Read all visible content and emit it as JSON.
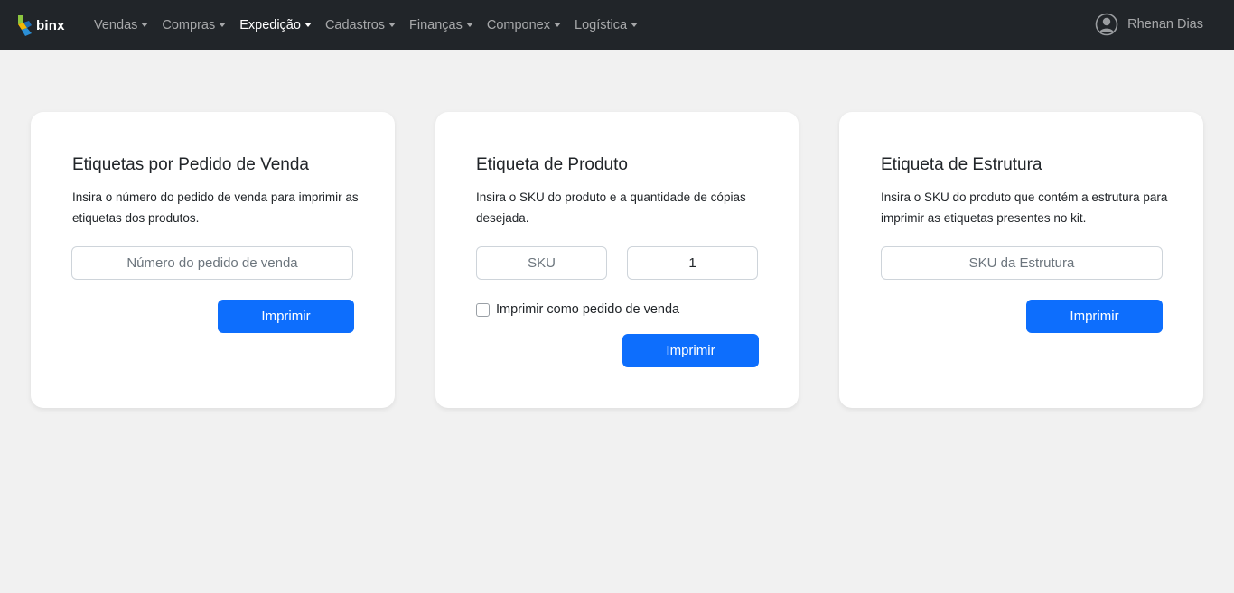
{
  "brand": {
    "name": "binx",
    "logo_icon": "binx-logo-icon"
  },
  "nav": {
    "items": [
      {
        "label": "Vendas"
      },
      {
        "label": "Compras"
      },
      {
        "label": "Expedição",
        "active": true
      },
      {
        "label": "Cadastros"
      },
      {
        "label": "Finanças"
      },
      {
        "label": "Componex"
      },
      {
        "label": "Logística"
      }
    ]
  },
  "user": {
    "name": "Rhenan Dias",
    "icon": "user-circle-icon"
  },
  "cards": {
    "sales_order": {
      "title": "Etiquetas por Pedido de Venda",
      "description": "Insira o número do pedido de venda para imprimir as etiquetas dos produtos.",
      "input_placeholder": "Número do pedido de venda",
      "input_value": "",
      "button_label": "Imprimir"
    },
    "product": {
      "title": "Etiqueta de Produto",
      "description": "Insira o SKU do produto e a quantidade de cópias desejada.",
      "sku_placeholder": "SKU",
      "sku_value": "",
      "quantity_value": "1",
      "checkbox_label": "Imprimir como pedido de venda",
      "checkbox_checked": false,
      "button_label": "Imprimir"
    },
    "structure": {
      "title": "Etiqueta de Estrutura",
      "description": "Insira o SKU do produto que contém a estrutura para imprimir as etiquetas presentes no kit.",
      "input_placeholder": "SKU da Estrutura",
      "input_value": "",
      "button_label": "Imprimir"
    }
  },
  "colors": {
    "navbar_bg": "#212529",
    "page_bg": "#f1f1f1",
    "primary": "#0d6efd",
    "logo_green": "#8cc63f",
    "logo_blue": "#2b8fd6",
    "logo_yellow": "#f2b705"
  }
}
